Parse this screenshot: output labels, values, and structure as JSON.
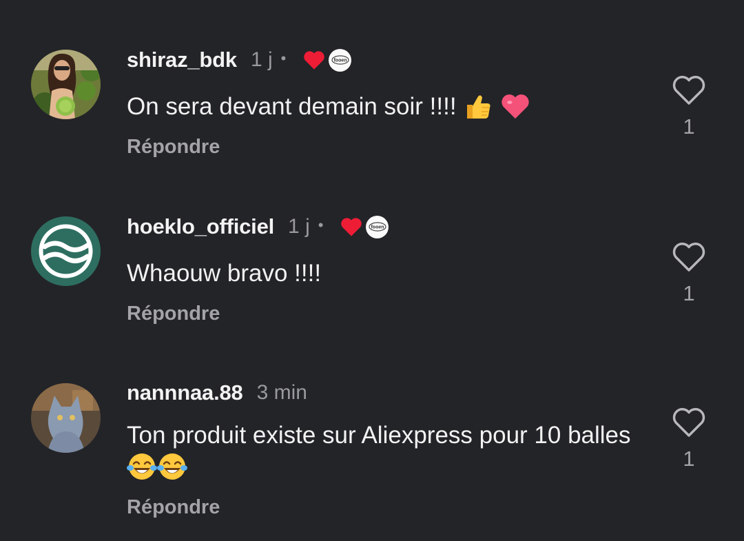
{
  "reply_label": "Répondre",
  "creator_badge_text": "fooen",
  "colors": {
    "background": "#232428",
    "heart_red": "#ee1d36",
    "muted": "#9a9a9e"
  },
  "comments": [
    {
      "username": "shiraz_bdk",
      "time": "1 j",
      "separator": "•",
      "creator_liked": true,
      "text": "On sera devant demain soir !!!!",
      "emojis": [
        "thumbs-up-emoji",
        "pink-heart-emoji"
      ],
      "likes": "1"
    },
    {
      "username": "hoeklo_officiel",
      "time": "1 j",
      "separator": "•",
      "creator_liked": true,
      "text": "Whaouw bravo !!!!",
      "emojis": [],
      "likes": "1"
    },
    {
      "username": "nannnaa.88",
      "time": "3 min",
      "creator_liked": false,
      "text": "Ton produit existe sur Aliexpress pour 10 balles",
      "emojis": [
        "tears-of-joy-emoji",
        "tears-of-joy-emoji"
      ],
      "likes": "1"
    }
  ]
}
